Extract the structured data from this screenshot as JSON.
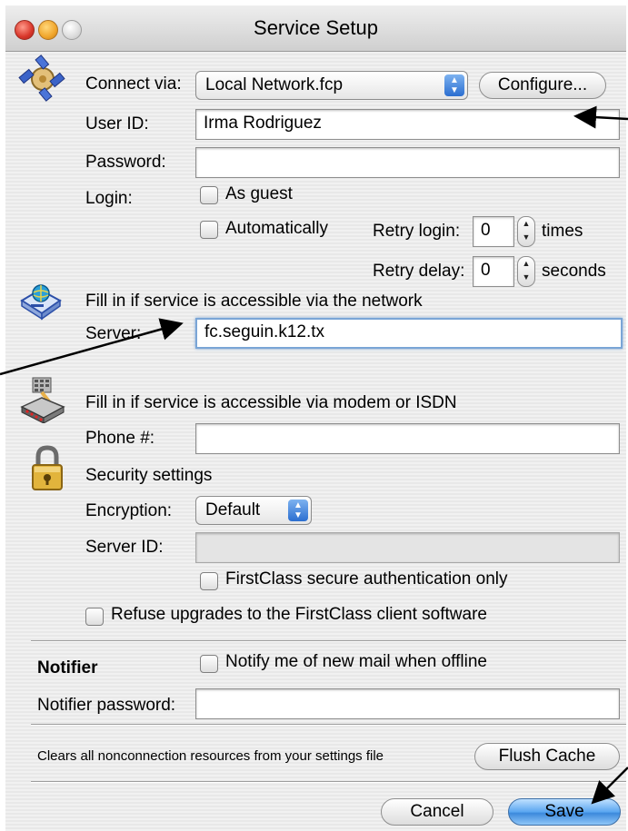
{
  "window": {
    "title": "Service Setup"
  },
  "connection": {
    "connect_via_label": "Connect via:",
    "connect_via_value": "Local Network.fcp",
    "configure_button": "Configure...",
    "user_id_label": "User ID:",
    "user_id_value": "Irma Rodriguez",
    "password_label": "Password:",
    "password_value": "",
    "login_label": "Login:",
    "as_guest_label": "As guest",
    "automatically_label": "Automatically",
    "retry_login_label": "Retry login:",
    "retry_login_value": "0",
    "retry_login_unit": "times",
    "retry_delay_label": "Retry delay:",
    "retry_delay_value": "0",
    "retry_delay_unit": "seconds"
  },
  "network": {
    "heading": "Fill in if service is accessible via the network",
    "server_label": "Server:",
    "server_value": "fc.seguin.k12.tx"
  },
  "modem": {
    "heading": "Fill in if service is accessible via modem or ISDN",
    "phone_label": "Phone #:",
    "phone_value": ""
  },
  "security": {
    "heading": "Security settings",
    "encryption_label": "Encryption:",
    "encryption_value": "Default",
    "server_id_label": "Server ID:",
    "server_id_value": "",
    "secure_auth_label": "FirstClass secure authentication only",
    "refuse_upgrades_label": "Refuse upgrades to the FirstClass client software"
  },
  "notifier": {
    "heading": "Notifier",
    "notify_label": "Notify me of new mail when offline",
    "password_label": "Notifier password:",
    "password_value": ""
  },
  "cache": {
    "description": "Clears all nonconnection resources from your settings file",
    "flush_button": "Flush Cache"
  },
  "footer": {
    "cancel_button": "Cancel",
    "save_button": "Save"
  },
  "icons": {
    "connection": "satellite-icon",
    "network": "network-globe-icon",
    "modem": "modem-icon",
    "security": "padlock-icon"
  },
  "colors": {
    "default_button": "#4a96e6",
    "focus_ring": "#7aa5d6",
    "popup_arrows": "#2b6ed0"
  }
}
